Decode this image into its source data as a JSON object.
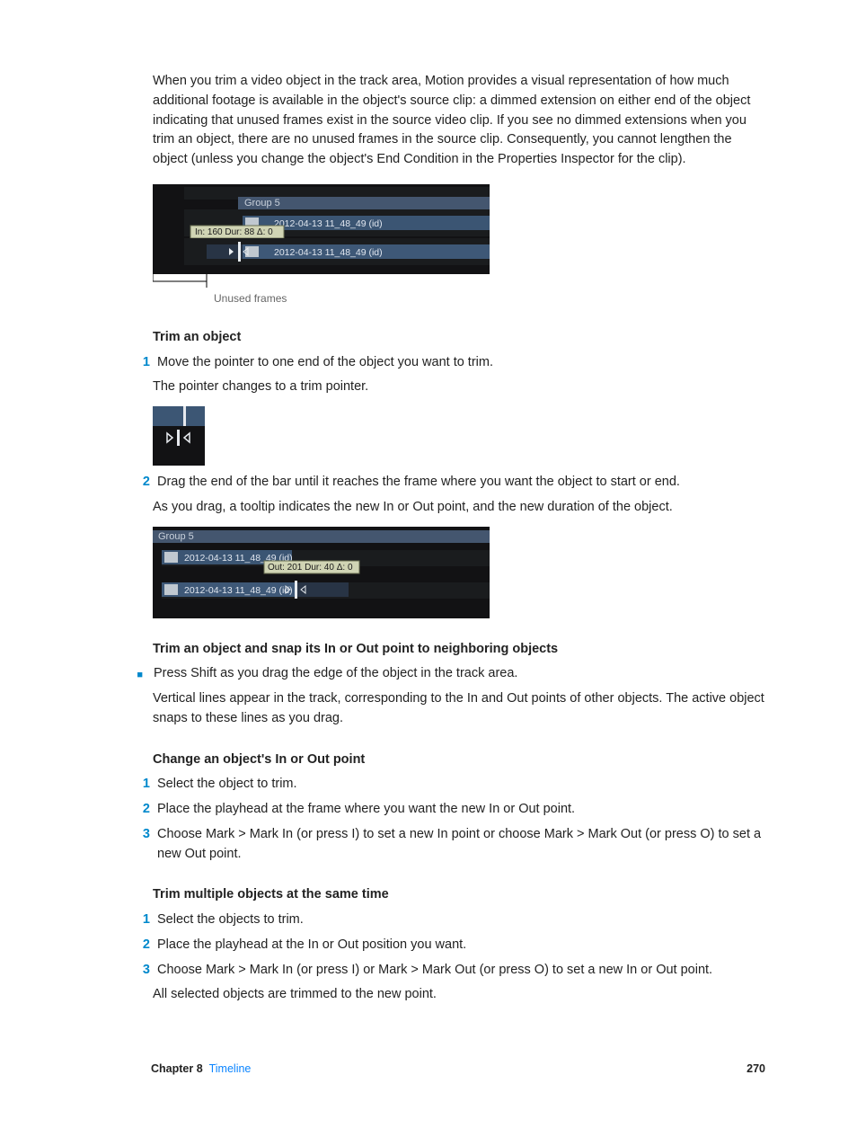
{
  "intro": "When you trim a video object in the track area, Motion provides a visual representation of how much additional footage is available in the object's source clip: a dimmed extension on either end of the object indicating that unused frames exist in the source video clip. If you see no dimmed extensions when you trim an object, there are no unused frames in the source clip. Consequently, you cannot lengthen the object (unless you change the object's End Condition in the Properties Inspector for the clip).",
  "fig1": {
    "group_label": "Group 5",
    "clip_label_a": "2012-04-13 11_48_49 (id)",
    "tooltip": "In: 160 Dur: 88 Δ: 0",
    "clip_label_b": "2012-04-13 11_48_49 (id)",
    "caption": "Unused frames"
  },
  "sec1": {
    "head": "Trim an object",
    "step1": "Move the pointer to one end of the object you want to trim.",
    "after1": "The pointer changes to a trim pointer.",
    "step2": "Drag the end of the bar until it reaches the frame where you want the object to start or end.",
    "after2": "As you drag, a tooltip indicates the new In or Out point, and the new duration of the object."
  },
  "fig3": {
    "group_label": "Group 5",
    "clip_label_a": "2012-04-13 11_48_49 (id)",
    "tooltip": "Out: 201 Dur: 40 Δ: 0",
    "clip_label_b": "2012-04-13 11_48_49 (id)"
  },
  "sec2": {
    "head": "Trim an object and snap its In or Out point to neighboring objects",
    "bullet": "Press Shift as you drag the edge of the object in the track area.",
    "after": "Vertical lines appear in the track, corresponding to the In and Out points of other objects. The active object snaps to these lines as you drag."
  },
  "sec3": {
    "head": "Change an object's In or Out point",
    "step1": "Select the object to trim.",
    "step2": "Place the playhead at the frame where you want the new In or Out point.",
    "step3": "Choose Mark > Mark In (or press I) to set a new In point or choose Mark > Mark Out (or press O) to set a new Out point."
  },
  "sec4": {
    "head": "Trim multiple objects at the same time",
    "step1": "Select the objects to trim.",
    "step2": "Place the playhead at the In or Out position you want.",
    "step3": "Choose Mark > Mark In (or press I) or Mark > Mark Out (or press O) to set a new In or Out point.",
    "after3": "All selected objects are trimmed to the new point."
  },
  "footer": {
    "chapter_lbl": "Chapter 8",
    "chapter_name": "Timeline",
    "page": "270"
  }
}
